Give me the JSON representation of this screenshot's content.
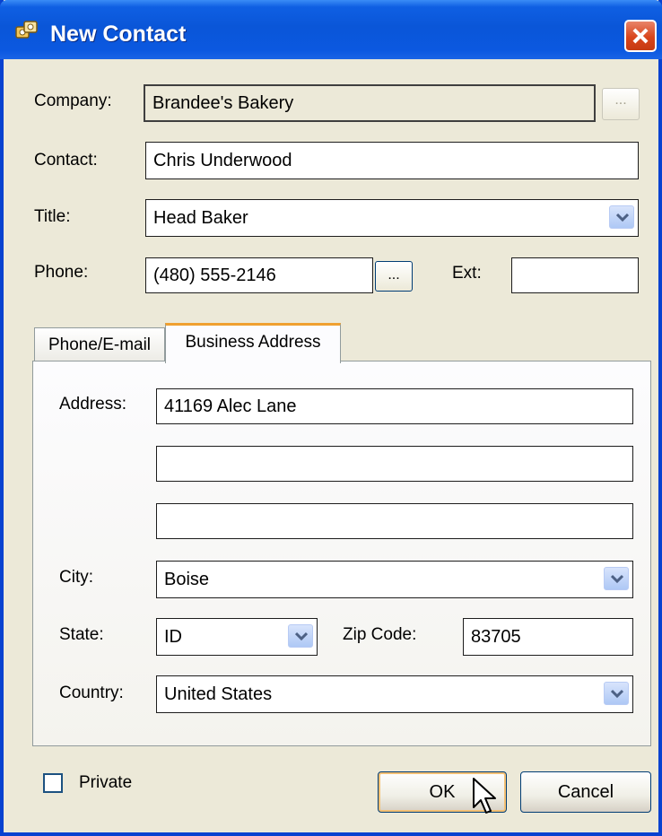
{
  "window": {
    "title": "New Contact"
  },
  "form": {
    "company": {
      "label": "Company:",
      "value": "Brandee's Bakery",
      "browse_label": "..."
    },
    "contact": {
      "label": "Contact:",
      "value": "Chris Underwood"
    },
    "title": {
      "label": "Title:",
      "value": "Head Baker"
    },
    "phone": {
      "label": "Phone:",
      "value": "(480) 555-2146",
      "browse_label": "...",
      "ext_label": "Ext:",
      "ext_value": ""
    }
  },
  "tabs": [
    {
      "label": "Phone/E-mail",
      "active": false
    },
    {
      "label": "Business Address",
      "active": true
    }
  ],
  "address": {
    "address_label": "Address:",
    "line1": "41169 Alec Lane",
    "line2": "",
    "line3": "",
    "city_label": "City:",
    "city": "Boise",
    "state_label": "State:",
    "state": "ID",
    "zip_label": "Zip Code:",
    "zip": "83705",
    "country_label": "Country:",
    "country": "United States"
  },
  "footer": {
    "private_label": "Private",
    "private_checked": false,
    "ok_label": "OK",
    "cancel_label": "Cancel"
  },
  "colors": {
    "titlebar": "#0a56d8",
    "face": "#ece9d8",
    "tab_highlight": "#f0a030",
    "close": "#d9451c"
  }
}
